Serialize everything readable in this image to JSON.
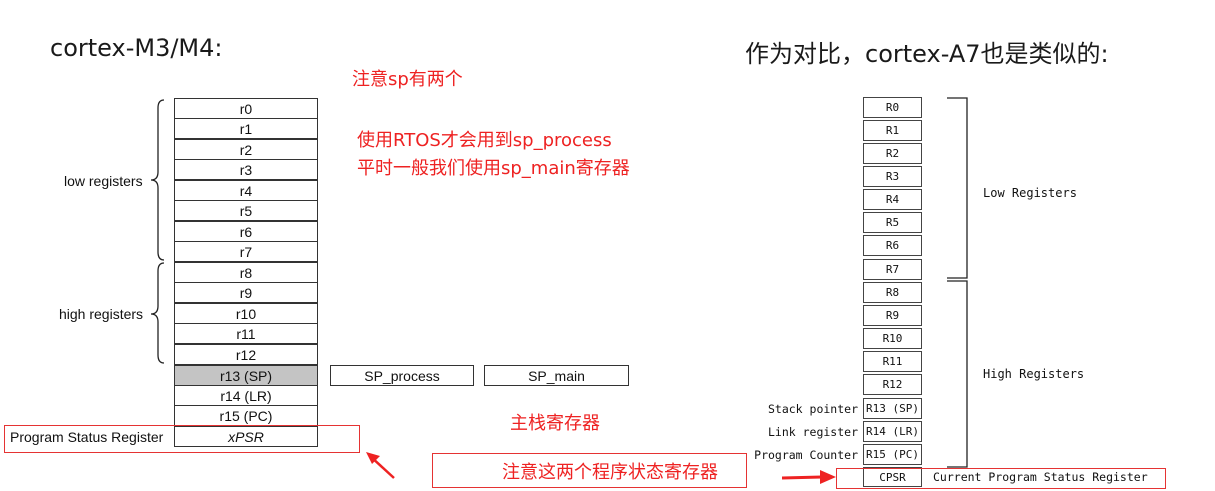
{
  "left": {
    "title": "cortex-M3/M4:",
    "registers": [
      "r0",
      "r1",
      "r2",
      "r3",
      "r4",
      "r5",
      "r6",
      "r7",
      "r8",
      "r9",
      "r10",
      "r11",
      "r12",
      "r13 (SP)",
      "r14 (LR)",
      "r15 (PC)",
      "xPSR"
    ],
    "low_label": "low registers",
    "high_label": "high registers",
    "sp_process": "SP_process",
    "sp_main": "SP_main",
    "psr_label": "Program Status Register"
  },
  "right": {
    "title": "作为对比，cortex-A7也是类似的:",
    "registers": [
      "R0",
      "R1",
      "R2",
      "R3",
      "R4",
      "R5",
      "R6",
      "R7",
      "R8",
      "R9",
      "R10",
      "R11",
      "R12",
      "R13 (SP)",
      "R14 (LR)",
      "R15 (PC)",
      "CPSR"
    ],
    "low_label": "Low Registers",
    "high_label": "High Registers",
    "stack_pointer": "Stack pointer",
    "link_register": "Link register",
    "program_counter": "Program Counter",
    "cpsr_desc": "Current Program Status Register"
  },
  "annotations": {
    "sp_two": "注意sp有两个",
    "rtos_line1": "使用RTOS才会用到sp_process",
    "rtos_line2": "平时一般我们使用sp_main寄存器",
    "main_stack": "主栈寄存器",
    "psr_note": "注意这两个程序状态寄存器"
  },
  "colors": {
    "accent_red": "#ee2222",
    "sp_cell": "#c4c4c4"
  }
}
